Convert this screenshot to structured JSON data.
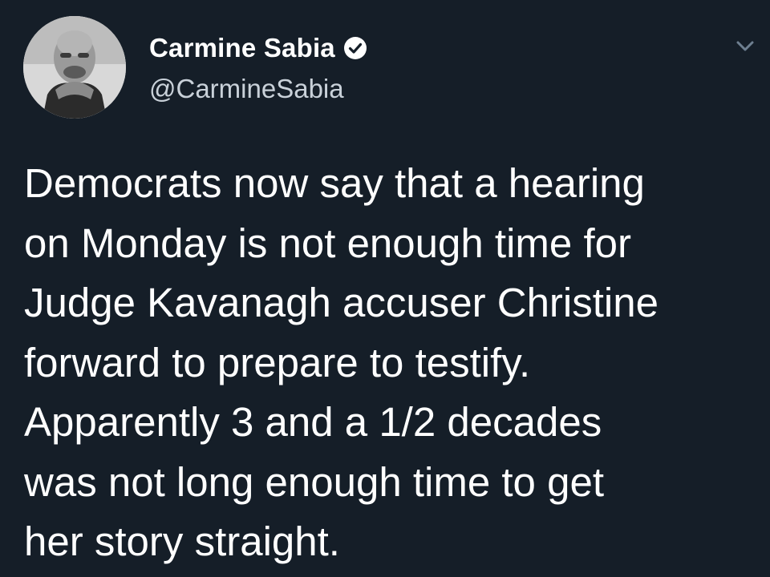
{
  "tweet": {
    "author": {
      "display_name": "Carmine Sabia",
      "handle": "@CarmineSabia",
      "verified": true,
      "avatar_icon": "profile-photo"
    },
    "menu_icon": "chevron-down-icon",
    "text_lines": [
      "Democrats now say that a hearing",
      "on Monday is not enough time for",
      "Judge Kavanagh accuser Christine",
      "forward to prepare to testify.",
      "Apparently 3 and a 1/2 decades",
      "was not long enough time to get",
      "her story straight."
    ]
  },
  "colors": {
    "background": "#151e28",
    "text": "#ffffff",
    "handle": "#c9d1d9",
    "chevron": "#6e7f90"
  }
}
